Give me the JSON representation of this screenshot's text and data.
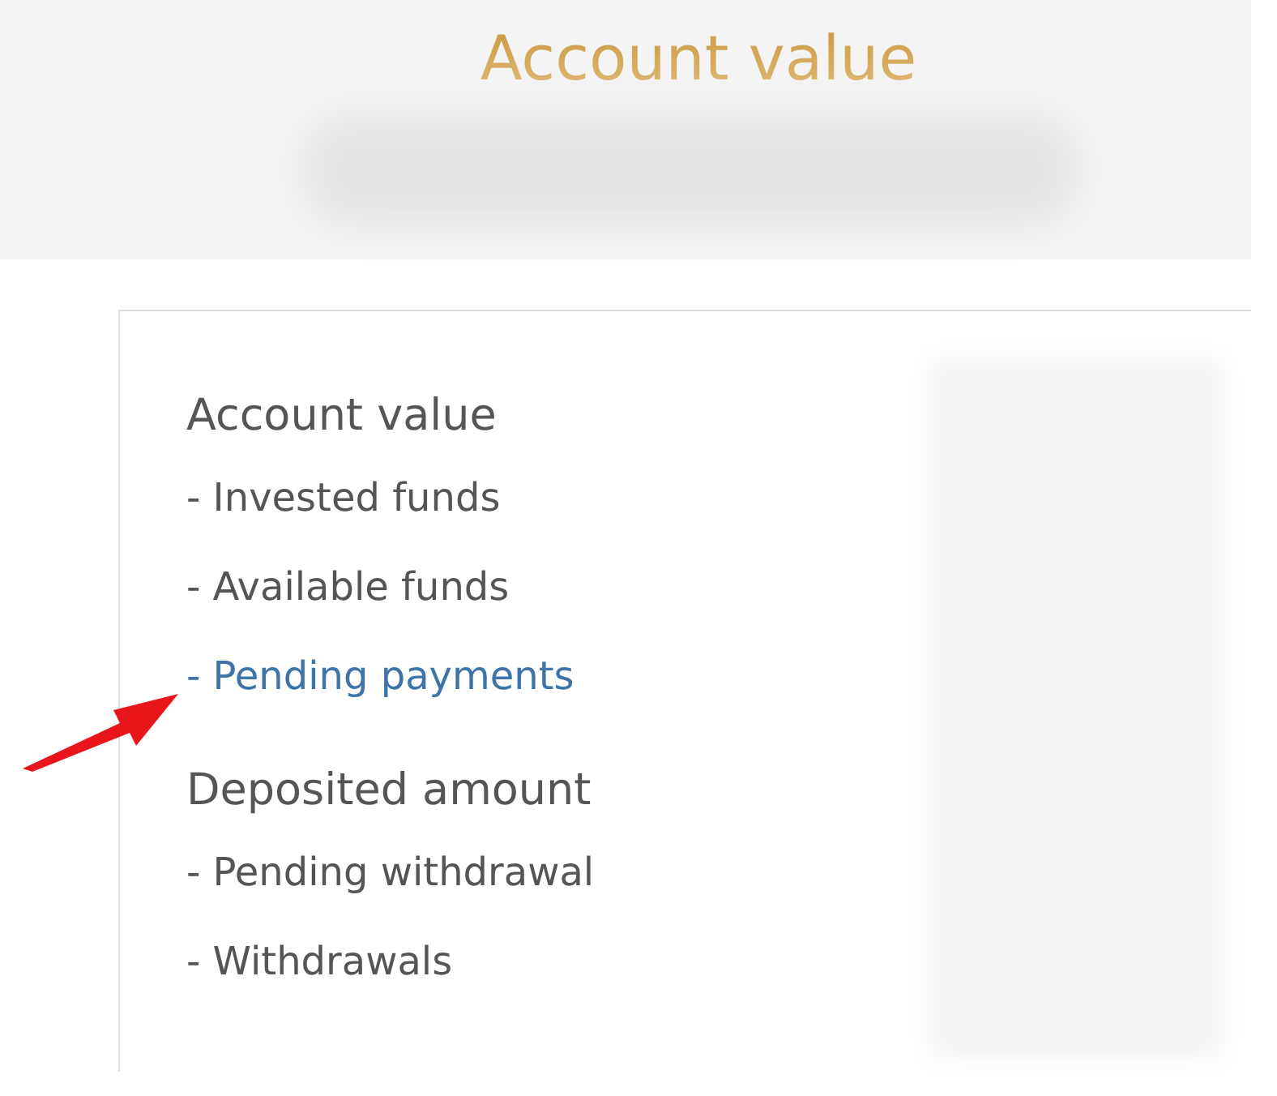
{
  "header": {
    "title": "Account value"
  },
  "sections": [
    {
      "title": "Account value",
      "items": [
        {
          "label": "- Invested funds",
          "kind": "text"
        },
        {
          "label": "- Available funds",
          "kind": "text"
        },
        {
          "label": "- Pending payments",
          "kind": "link"
        }
      ]
    },
    {
      "title": "Deposited amount",
      "items": [
        {
          "label": "- Pending withdrawal",
          "kind": "text"
        },
        {
          "label": "- Withdrawals",
          "kind": "text"
        }
      ]
    }
  ]
}
